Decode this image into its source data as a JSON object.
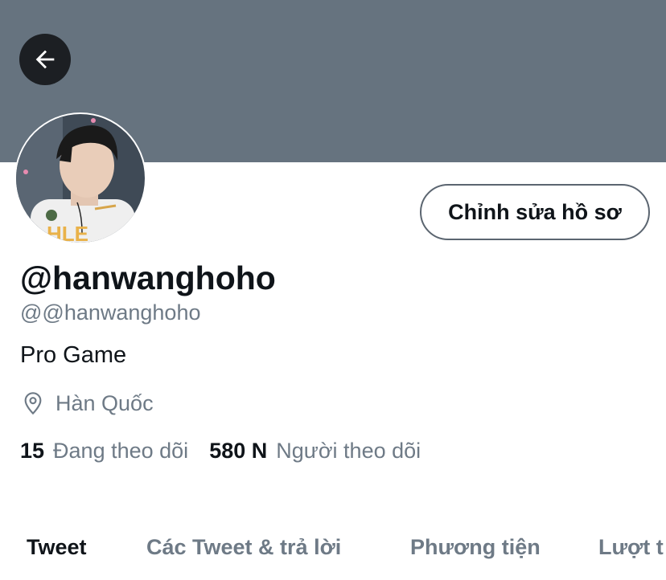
{
  "profile": {
    "display_name": "@hanwanghoho",
    "handle": "@@hanwanghoho",
    "bio": "Pro Game",
    "location": "Hàn Quốc",
    "following_count": "15",
    "following_label": "Đang theo dõi",
    "followers_count": "580 N",
    "followers_label": "Người theo dõi"
  },
  "actions": {
    "edit_profile_label": "Chỉnh sửa hồ sơ"
  },
  "tabs": [
    {
      "label": "Tweet",
      "active": true
    },
    {
      "label": "Các Tweet & trả lời",
      "active": false
    },
    {
      "label": "Phương tiện",
      "active": false
    },
    {
      "label": "Lượt t",
      "active": false
    }
  ],
  "icons": {
    "back": "arrow-left-icon",
    "location": "location-pin-icon"
  },
  "colors": {
    "banner": "#66737f",
    "text_primary": "#0f1419",
    "text_secondary": "#6e7a86"
  }
}
